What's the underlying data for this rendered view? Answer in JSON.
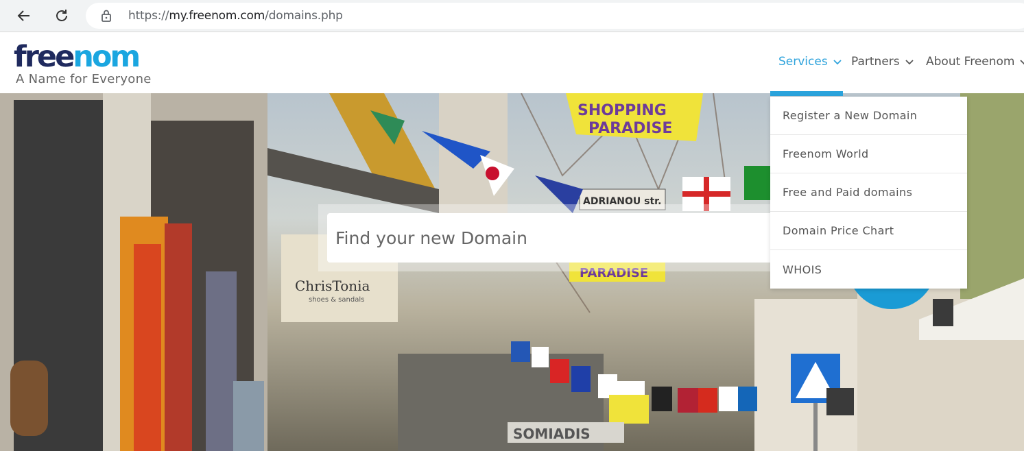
{
  "browser": {
    "url_prefix": "https://",
    "url_host": "my.freenom.com",
    "url_path": "/domains.php"
  },
  "header": {
    "logo_free": "free",
    "logo_nom": "nom",
    "tagline": "A Name for Everyone",
    "nav": [
      {
        "label": "Services",
        "active": true
      },
      {
        "label": "Partners",
        "active": false
      },
      {
        "label": "About Freenom",
        "active": false
      }
    ]
  },
  "hero": {
    "search_placeholder": "Find your new Domain",
    "sign_texts": {
      "banner_top_1": "SHOPPING",
      "banner_top_2": "PARADISE",
      "street_sign": "ADRIANOU str.",
      "banner_mid": "PARADISE",
      "shop_sign_1": "ChrisTonia",
      "shop_sign_2": "shoes & sandals",
      "store_name": "SOMIADIS"
    }
  },
  "services_menu": {
    "items": [
      "Register a New Domain",
      "Freenom World",
      "Free and Paid domains",
      "Domain Price Chart",
      "WHOIS"
    ]
  },
  "colors": {
    "accent": "#2ea3dc",
    "logo_dark": "#1f2a5e",
    "logo_light": "#1aa6e0"
  }
}
